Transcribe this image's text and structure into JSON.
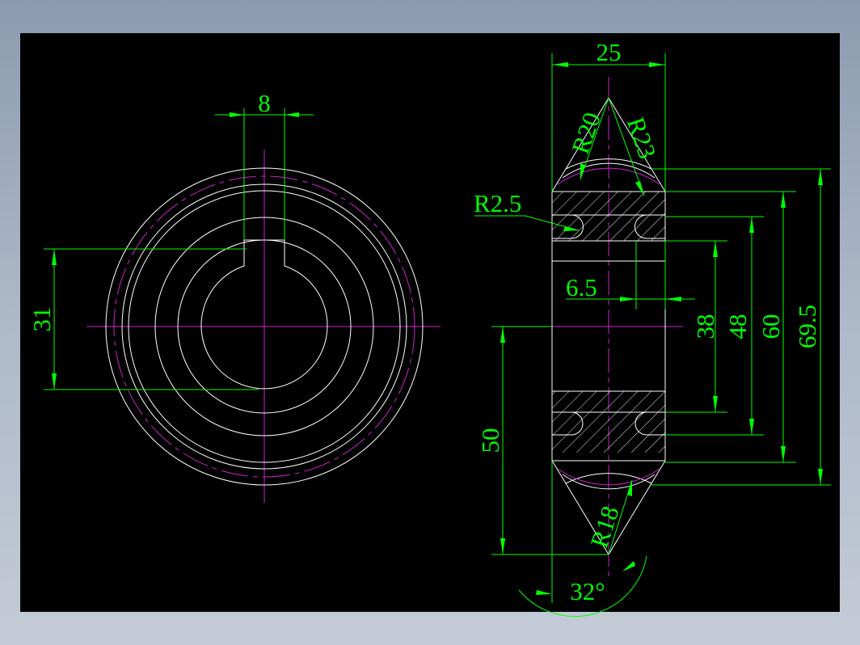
{
  "drawing": {
    "background": "#000000",
    "outline_color": "#ffffff",
    "centerline_color": "#d020d0",
    "dimension_color": "#00ff00",
    "dimensions": {
      "key_width": "8",
      "key_depth": "31",
      "width": "25",
      "r20": "R20",
      "r23": "R23",
      "r2_5": "R2.5",
      "d6_5": "6.5",
      "d38": "38",
      "d48": "48",
      "d60": "60",
      "d69_5": "69.5",
      "d50": "50",
      "r18": "R18",
      "angle": "32°"
    }
  }
}
